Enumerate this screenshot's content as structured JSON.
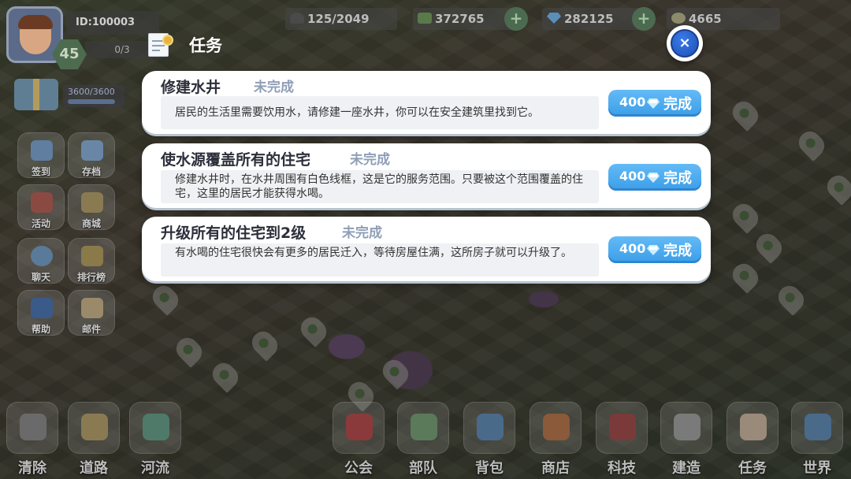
{
  "player": {
    "id": "ID:100003",
    "level": "45",
    "exp": "0/3",
    "energy": "3600/3600"
  },
  "resources": [
    {
      "icon": "population-icon",
      "value": "125/2049"
    },
    {
      "icon": "cash-icon",
      "value": "372765"
    },
    {
      "icon": "diamond-icon",
      "value": "282125"
    },
    {
      "icon": "coin-icon",
      "value": "4665"
    }
  ],
  "left_menu": [
    {
      "label": "签到",
      "icon": "checkin-icon"
    },
    {
      "label": "存档",
      "icon": "save-icon"
    },
    {
      "label": "活动",
      "icon": "gift-icon"
    },
    {
      "label": "商城",
      "icon": "shop-icon"
    },
    {
      "label": "聊天",
      "icon": "chat-icon"
    },
    {
      "label": "排行榜",
      "icon": "trophy-icon"
    },
    {
      "label": "帮助",
      "icon": "help-icon"
    },
    {
      "label": "邮件",
      "icon": "mail-icon"
    }
  ],
  "bottom_bar": [
    {
      "label": "清除",
      "icon": "shovel-icon"
    },
    {
      "label": "道路",
      "icon": "road-icon"
    },
    {
      "label": "河流",
      "icon": "river-icon"
    },
    {
      "label": "公会",
      "icon": "guild-icon"
    },
    {
      "label": "部队",
      "icon": "army-icon"
    },
    {
      "label": "背包",
      "icon": "backpack-icon"
    },
    {
      "label": "商店",
      "icon": "store-icon"
    },
    {
      "label": "科技",
      "icon": "tech-icon"
    },
    {
      "label": "建造",
      "icon": "hammer-icon"
    },
    {
      "label": "任务",
      "icon": "scroll-icon"
    },
    {
      "label": "世界",
      "icon": "world-map-icon"
    }
  ],
  "dialog": {
    "title": "任务",
    "close_label": "×",
    "tasks": [
      {
        "name": "修建水井",
        "status": "未完成",
        "description": "居民的生活里需要饮用水，请修建一座水井，你可以在安全建筑里找到它。",
        "reward_amount": "400",
        "reward_icon": "diamond-icon",
        "button_label": "完成"
      },
      {
        "name": "使水源覆盖所有的住宅",
        "status": "未完成",
        "description": "修建水井时，在水井周围有白色线框，这是它的服务范围。只要被这个范围覆盖的住宅，这里的居民才能获得水喝。",
        "reward_amount": "400",
        "reward_icon": "diamond-icon",
        "button_label": "完成"
      },
      {
        "name": "升级所有的住宅到2级",
        "status": "未完成",
        "description": "有水喝的住宅很快会有更多的居民迁入，等待房屋住满，这所房子就可以升级了。",
        "reward_amount": "400",
        "reward_icon": "diamond-icon",
        "button_label": "完成"
      }
    ]
  },
  "colors": {
    "button_blue": "#3b9ee8",
    "status_gray": "#8f9fb7",
    "close_blue": "#1c4fb5"
  }
}
